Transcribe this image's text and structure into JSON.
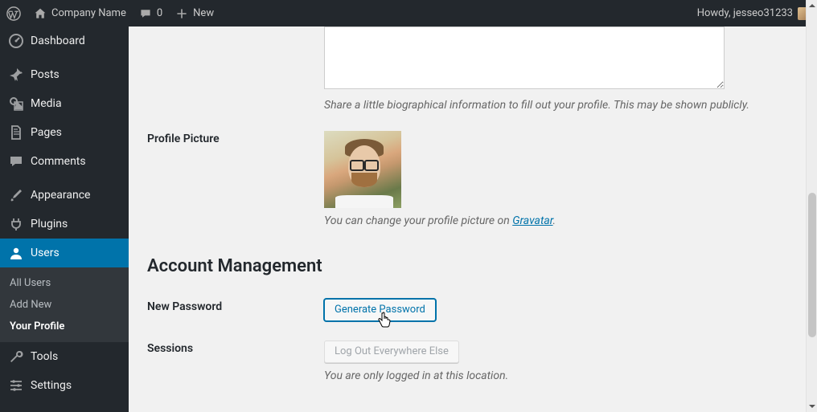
{
  "adminbar": {
    "site_name": "Company Name",
    "comments_count": "0",
    "new_label": "New",
    "howdy_text": "Howdy, jesseo31233"
  },
  "sidebar": {
    "dashboard": "Dashboard",
    "posts": "Posts",
    "media": "Media",
    "pages": "Pages",
    "comments": "Comments",
    "appearance": "Appearance",
    "plugins": "Plugins",
    "users": "Users",
    "tools": "Tools",
    "settings": "Settings",
    "users_submenu": {
      "all_users": "All Users",
      "add_new": "Add New",
      "your_profile": "Your Profile"
    }
  },
  "profile": {
    "bio_value": "",
    "bio_help": "Share a little biographical information to fill out your profile. This may be shown publicly.",
    "picture_label": "Profile Picture",
    "picture_help_prefix": "You can change your profile picture on ",
    "picture_help_link": "Gravatar",
    "account_section": "Account Management",
    "new_password_label": "New Password",
    "generate_password_btn": "Generate Password",
    "sessions_label": "Sessions",
    "logout_btn": "Log Out Everywhere Else",
    "sessions_help": "You are only logged in at this location."
  }
}
